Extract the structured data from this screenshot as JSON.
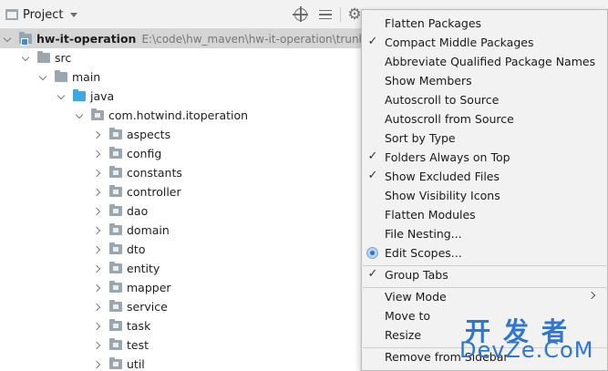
{
  "panel": {
    "title": "Project"
  },
  "tree": [
    {
      "label": "hw-it-operation",
      "path": "E:\\code\\hw_maven\\hw-it-operation\\trunk\\hw",
      "arrow": "down",
      "icon": "module",
      "bold": true
    },
    {
      "label": "src",
      "arrow": "down",
      "icon": "plain"
    },
    {
      "label": "main",
      "arrow": "down",
      "icon": "plain"
    },
    {
      "label": "java",
      "arrow": "down",
      "icon": "source"
    },
    {
      "label": "com.hotwind.itoperation",
      "arrow": "down",
      "icon": "package"
    },
    {
      "label": "aspects",
      "arrow": "right",
      "icon": "package"
    },
    {
      "label": "config",
      "arrow": "right",
      "icon": "package"
    },
    {
      "label": "constants",
      "arrow": "right",
      "icon": "package"
    },
    {
      "label": "controller",
      "arrow": "right",
      "icon": "package"
    },
    {
      "label": "dao",
      "arrow": "right",
      "icon": "package"
    },
    {
      "label": "domain",
      "arrow": "right",
      "icon": "package"
    },
    {
      "label": "dto",
      "arrow": "right",
      "icon": "package"
    },
    {
      "label": "entity",
      "arrow": "right",
      "icon": "package"
    },
    {
      "label": "mapper",
      "arrow": "right",
      "icon": "package"
    },
    {
      "label": "service",
      "arrow": "right",
      "icon": "package"
    },
    {
      "label": "task",
      "arrow": "right",
      "icon": "package"
    },
    {
      "label": "test",
      "arrow": "right",
      "icon": "package"
    },
    {
      "label": "util",
      "arrow": "right",
      "icon": "package"
    }
  ],
  "menu": {
    "items": [
      {
        "label": "Flatten Packages",
        "mark": ""
      },
      {
        "label": "Compact Middle Packages",
        "mark": "check"
      },
      {
        "label": "Abbreviate Qualified Package Names",
        "mark": ""
      },
      {
        "label": "Show Members",
        "mark": ""
      },
      {
        "label": "Autoscroll to Source",
        "mark": ""
      },
      {
        "label": "Autoscroll from Source",
        "mark": ""
      },
      {
        "label": "Sort by Type",
        "mark": ""
      },
      {
        "label": "Folders Always on Top",
        "mark": "check"
      },
      {
        "label": "Show Excluded Files",
        "mark": "check"
      },
      {
        "label": "Show Visibility Icons",
        "mark": ""
      },
      {
        "label": "Flatten Modules",
        "mark": ""
      },
      {
        "label": "File Nesting...",
        "mark": ""
      },
      {
        "label": "Edit Scopes...",
        "mark": "radio"
      },
      {
        "label": "Group Tabs",
        "mark": "check"
      },
      {
        "label": "View Mode",
        "mark": "",
        "submenu": true
      },
      {
        "label": "Move to",
        "mark": ""
      },
      {
        "label": "Resize",
        "mark": ""
      },
      {
        "label": "Remove from Sidebar",
        "mark": ""
      }
    ]
  },
  "watermark": {
    "cn": "开发者",
    "en": "DevZe.CoM"
  },
  "icons": {
    "locate": "crosshair-icon",
    "collapse": "collapse-all-icon",
    "settings": "gear-icon"
  }
}
